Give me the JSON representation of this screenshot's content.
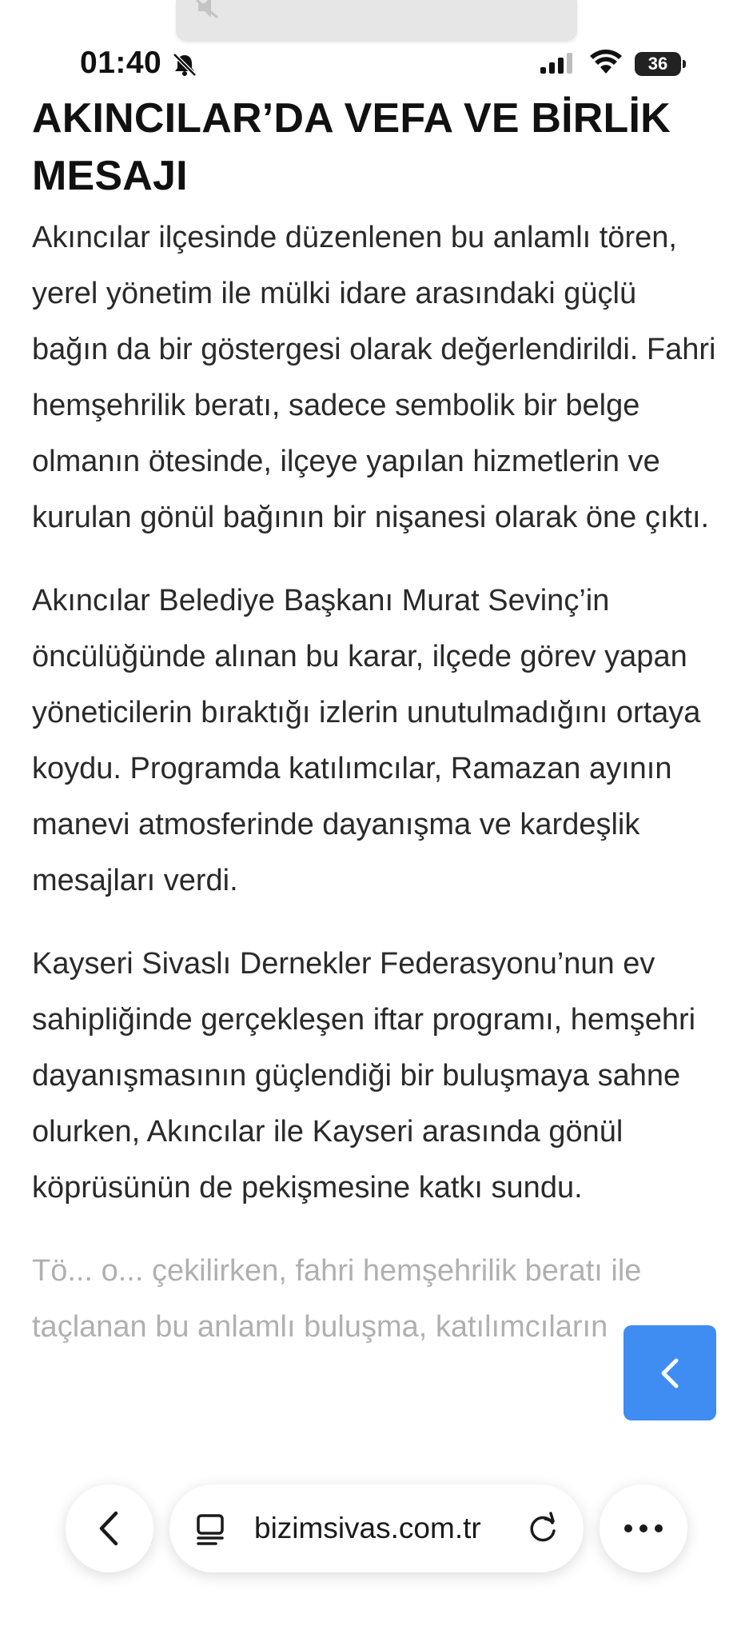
{
  "status_bar": {
    "time": "01:40",
    "battery": "36"
  },
  "article": {
    "headline": "AKINCILAR’DA VEFA VE BİRLİK MESAJI",
    "paragraphs": [
      "Akıncılar ilçesinde düzenlenen bu anlamlı tören, yerel yönetim ile mülki idare arasındaki güçlü bağın da bir göstergesi olarak değerlendirildi. Fahri hemşehrilik beratı, sadece sembolik bir belge olmanın ötesinde, ilçeye yapılan hizmetlerin ve kurulan gönül bağının bir nişanesi olarak öne çıktı.",
      "Akıncılar Belediye Başkanı Murat Sevinç’in öncülüğünde alınan bu karar, ilçede görev yapan yöneticilerin bıraktığı izlerin unutulmadığını ortaya koydu. Programda katılımcılar, Ramazan ayının manevi atmosferinde dayanışma ve kardeşlik mesajları verdi.",
      "Kayseri Sivaslı Dernekler Federasyonu’nun ev sahipliğinde gerçekleşen iftar programı, hemşehri dayanışmasının güçlendiği bir buluşmaya sahne olurken, Akıncılar ile Kayseri arasında gönül köprüsünün de pekişmesine katkı sundu."
    ],
    "partial_paragraph": "Tö... o... çekilirken, fahri hemşehrilik beratı ile taçlanan bu anlamlı buluşma, katılımcıların"
  },
  "browser": {
    "url": "bizimsivas.com.tr"
  },
  "icons": {
    "island": "mute-icon",
    "status": [
      "bell-off-icon",
      "signal-icon",
      "wifi-icon",
      "battery-icon"
    ],
    "floating": "chevron-left-icon",
    "toolbar": [
      "back-arrow-icon",
      "reader-icon",
      "reload-icon",
      "more-icon"
    ]
  },
  "colors": {
    "accent_button": "#3f8cf3",
    "text": "#2a2a2a",
    "headline": "#111111"
  }
}
